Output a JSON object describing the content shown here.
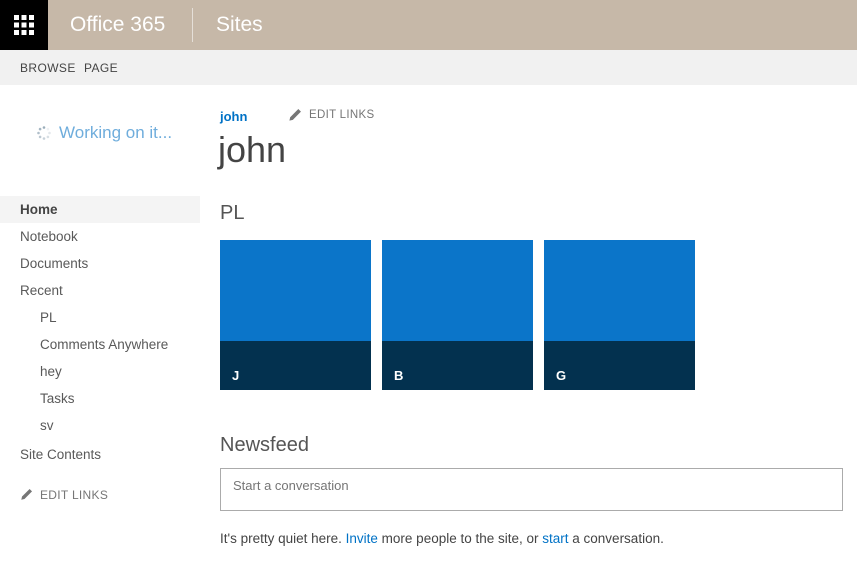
{
  "suite_bar": {
    "brand": "Office 365",
    "section": "Sites"
  },
  "ribbon": {
    "tabs": [
      {
        "label": "BROWSE"
      },
      {
        "label": "PAGE"
      }
    ]
  },
  "sidebar": {
    "loading_text": "Working on it...",
    "items": [
      {
        "label": "Home",
        "selected": true
      },
      {
        "label": "Notebook"
      },
      {
        "label": "Documents"
      },
      {
        "label": "Recent"
      },
      {
        "label": "PL",
        "indent": 1
      },
      {
        "label": "Comments Anywhere",
        "indent": 1
      },
      {
        "label": "hey",
        "indent": 1
      },
      {
        "label": "Tasks",
        "indent": 1
      },
      {
        "label": "sv",
        "indent": 1
      },
      {
        "label": "Site Contents"
      }
    ],
    "edit_links_label": "EDIT LINKS"
  },
  "main": {
    "breadcrumb": {
      "link": "john",
      "edit_links_label": "EDIT LINKS"
    },
    "page_title": "john",
    "pl_section": {
      "heading": "PL",
      "tiles": [
        {
          "letter": "J"
        },
        {
          "letter": "B"
        },
        {
          "letter": "G"
        }
      ]
    },
    "newsfeed": {
      "heading": "Newsfeed",
      "composer_placeholder": "Start a conversation",
      "empty_message": {
        "prefix": "It's pretty quiet here. ",
        "invite_link": "Invite",
        "middle": " more people to the site, or ",
        "start_link": "start",
        "suffix": " a conversation."
      }
    }
  },
  "colors": {
    "accent": "#0072c6",
    "suite-bar-bg": "#c6b8a8",
    "launcher-bg": "#000000",
    "ribbon-bg": "#f1f1f1",
    "tile-top": "#0b75c9",
    "tile-bottom": "#03314f",
    "loading-text": "#6faddc",
    "selected-nav-bg": "#f4f4f4",
    "muted-text": "#767676",
    "body-text": "#444444",
    "nav-text": "#595959",
    "heading-text": "#555555",
    "composer-border": "#ababab"
  }
}
